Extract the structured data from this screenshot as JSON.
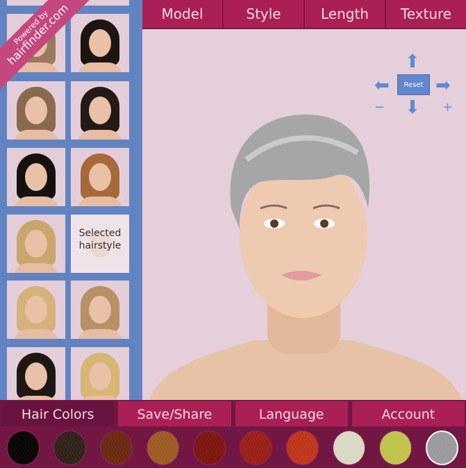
{
  "branding": {
    "powered_by": "Powered by",
    "site": "hairfinder.com"
  },
  "thumbnails": {
    "selected_label": "Selected hairstyle",
    "items": [
      {
        "hair": "#9a7a5c"
      },
      {
        "hair": "#1c1512"
      },
      {
        "hair": "#8a6a4e"
      },
      {
        "hair": "#241a15"
      },
      {
        "hair": "#151110"
      },
      {
        "hair": "#a8693a"
      },
      {
        "hair": "#c9a66b"
      },
      {
        "hair": "selected"
      },
      {
        "hair": "#d4b27a"
      },
      {
        "hair": "#b89064"
      },
      {
        "hair": "#1f1713"
      },
      {
        "hair": "#d6b673"
      }
    ]
  },
  "top_tabs": [
    "Model",
    "Style",
    "Length",
    "Texture"
  ],
  "nav": {
    "reset": "Reset",
    "minus": "−",
    "plus": "+"
  },
  "bottom_tabs": [
    {
      "label": "Hair Colors",
      "active": true
    },
    {
      "label": "Save/Share"
    },
    {
      "label": "Language"
    },
    {
      "label": "Account"
    }
  ],
  "hair_colors": [
    {
      "color": "#050303"
    },
    {
      "color": "#2e2119"
    },
    {
      "color": "#6a2710"
    },
    {
      "color": "#9c5a22"
    },
    {
      "color": "#7d140f"
    },
    {
      "color": "#981e16"
    },
    {
      "color": "#bf3418"
    },
    {
      "color": "#d8d8c4"
    },
    {
      "color": "#bfc24a"
    },
    {
      "color": "#9a9a9c",
      "selected": true
    }
  ]
}
